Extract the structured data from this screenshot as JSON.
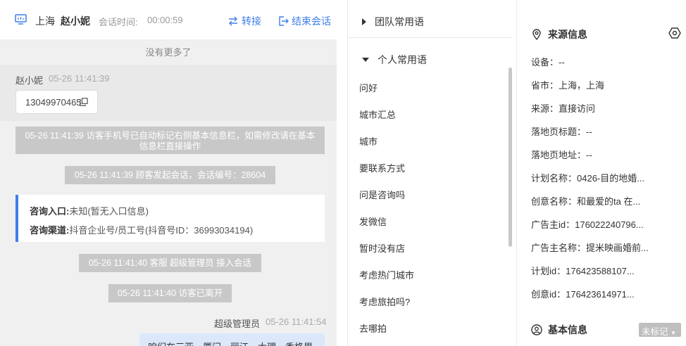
{
  "header": {
    "city": "上海",
    "visitor_name": "赵小妮",
    "time_label": "会话时间:",
    "time_value": "00:00:59",
    "transfer_label": "转接",
    "end_label": "结束会话"
  },
  "chat": {
    "no_more": "没有更多了",
    "visitor_msg": {
      "name": "赵小妮",
      "time": "05-26 11:41:39",
      "phone": "13049970465"
    },
    "system_msgs": [
      "05-26 11:41:39 访客手机号已自动标记右侧基本信息栏，如需修改请在基本信息栏直接操作",
      "05-26 11:41:39 顾客发起会话，会话编号：28604",
      "05-26 11:41:40 客服 超级管理员 接入会话",
      "05-26 11:41:40 访客已离开"
    ],
    "consult": {
      "entry_label": "咨询入口:",
      "entry_value": "未知(暂无入口信息)",
      "channel_label": "咨询渠道:",
      "channel_value": "抖音企业号/员工号(抖音号ID：36993034194)"
    },
    "agent_msg": {
      "name": "超级管理员",
      "time": "05-26 11:41:54",
      "text": "咱们在三亚、厦门、丽江、大理、香格里"
    }
  },
  "phrases": {
    "team_group": "团队常用语",
    "personal_group": "个人常用语",
    "items": [
      "问好",
      "城市汇总",
      "城市",
      "要联系方式",
      "问是咨询吗",
      "发微信",
      "暂时没有店",
      "考虑热门城市",
      "考虑旅拍吗?",
      "去哪拍"
    ]
  },
  "info": {
    "source_title": "来源信息",
    "rows": [
      "设备：--",
      "省市：上海，上海",
      "来源：直接访问",
      "落地页标题：--",
      "落地页地址：--",
      "计划名称：0426-目的地婚...",
      "创意名称：和最爱的ta 在...",
      "广告主id：176022240796...",
      "广告主名称：提米映画婚前...",
      "计划id：176423588107...",
      "创意id：176423614971..."
    ],
    "basic_title": "基本信息",
    "unmarked_label": "未标记"
  }
}
